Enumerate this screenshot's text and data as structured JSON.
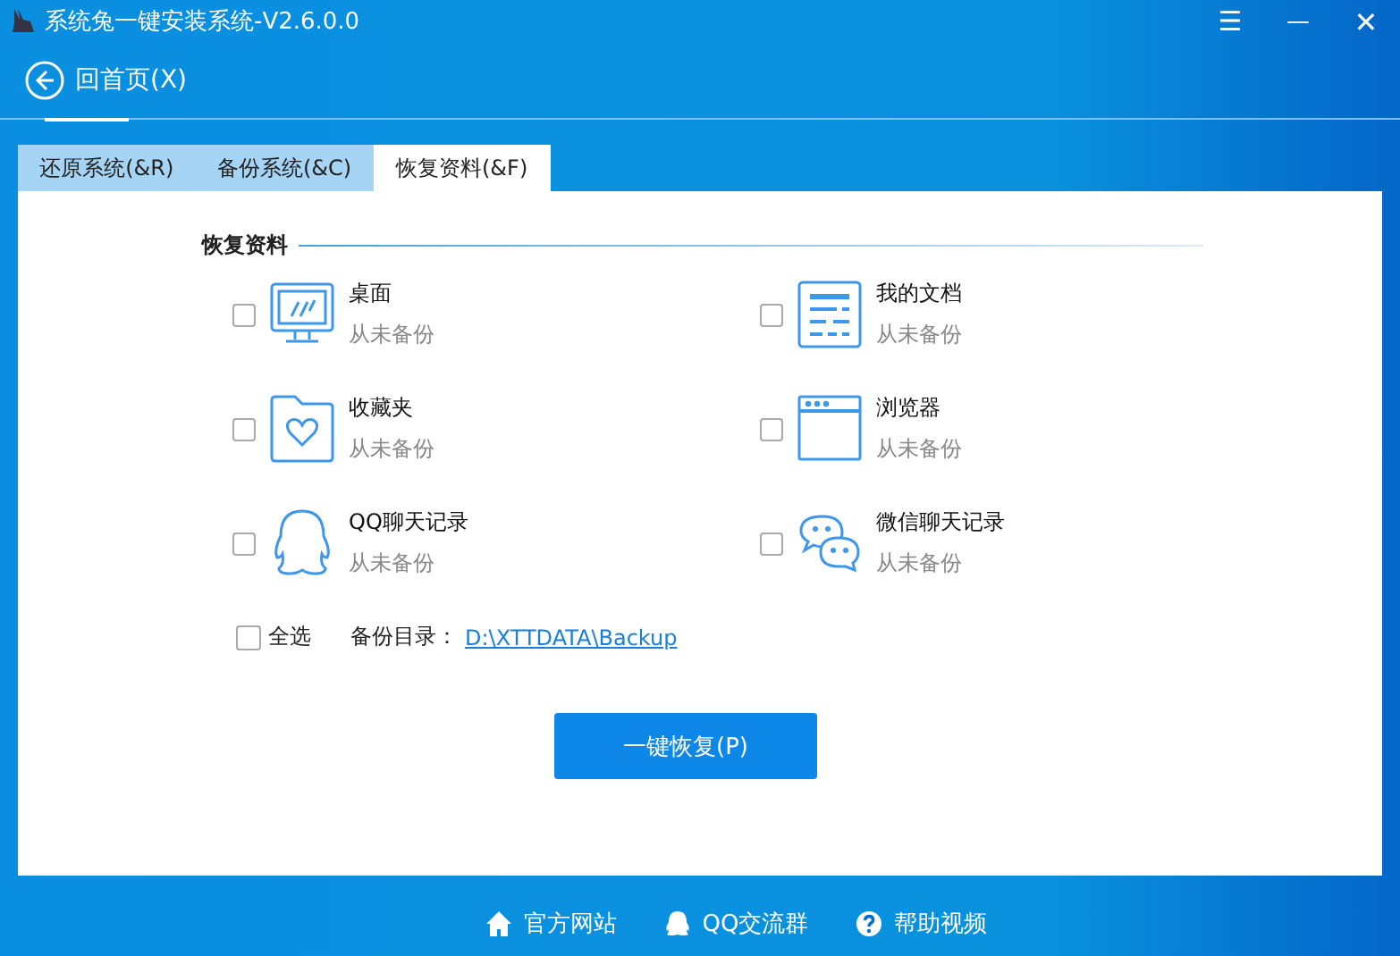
{
  "window": {
    "title": "系统兔一键安装系统-V2.6.0.0",
    "controls": [
      {
        "kind": "menu",
        "label": "☰"
      },
      {
        "kind": "minimize",
        "label": "—"
      },
      {
        "kind": "close",
        "label": "✕"
      }
    ]
  },
  "back": {
    "label": "回首页(X)"
  },
  "tabs": [
    {
      "label": "还原系统(&R)",
      "selected": false
    },
    {
      "label": "备份系统(&C)",
      "selected": false
    },
    {
      "label": "恢复资料(&F)",
      "selected": true
    }
  ],
  "section": {
    "title": "恢复资料"
  },
  "items": [
    {
      "kind": "desktop",
      "name": "桌面",
      "status": "从未备份",
      "checked": false
    },
    {
      "kind": "documents",
      "name": "我的文档",
      "status": "从未备份",
      "checked": false
    },
    {
      "kind": "favorites",
      "name": "收藏夹",
      "status": "从未备份",
      "checked": false
    },
    {
      "kind": "browser",
      "name": "浏览器",
      "status": "从未备份",
      "checked": false
    },
    {
      "kind": "qq",
      "name": "QQ聊天记录",
      "status": "从未备份",
      "checked": false
    },
    {
      "kind": "wechat",
      "name": "微信聊天记录",
      "status": "从未备份",
      "checked": false
    }
  ],
  "select_all": {
    "label": "全选",
    "checked": false
  },
  "backup_dir": {
    "label": "备份目录：",
    "path": "D:\\XTTDATA\\Backup"
  },
  "restore_button": {
    "label": "一键恢复(P)"
  },
  "footer": [
    {
      "kind": "home",
      "label": "官方网站"
    },
    {
      "kind": "qq",
      "label": "QQ交流群"
    },
    {
      "kind": "help",
      "label": "帮助视频"
    }
  ]
}
